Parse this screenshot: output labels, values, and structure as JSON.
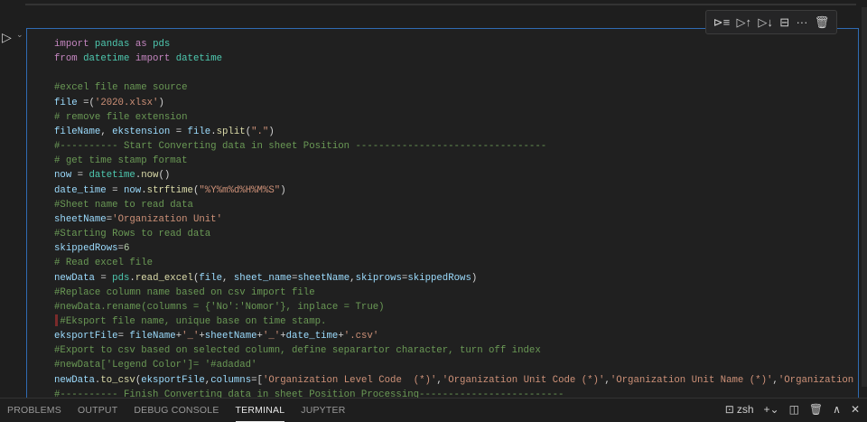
{
  "toolbar": {
    "icons": [
      "run-by-line-icon",
      "execute-above-icon",
      "execute-below-icon",
      "split-cell-icon",
      "more-icon",
      "delete-icon"
    ]
  },
  "code_lines": [
    [
      [
        "k",
        "import"
      ],
      [
        "d",
        " "
      ],
      [
        "m",
        "pandas"
      ],
      [
        "d",
        " "
      ],
      [
        "k",
        "as"
      ],
      [
        "d",
        " "
      ],
      [
        "m",
        "pds"
      ]
    ],
    [
      [
        "k",
        "from"
      ],
      [
        "d",
        " "
      ],
      [
        "m",
        "datetime"
      ],
      [
        "d",
        " "
      ],
      [
        "k",
        "import"
      ],
      [
        "d",
        " "
      ],
      [
        "m",
        "datetime"
      ]
    ],
    [],
    [
      [
        "c",
        "#excel file name source"
      ]
    ],
    [
      [
        "v",
        "file"
      ],
      [
        "d",
        " =("
      ],
      [
        "s",
        "'2020.xlsx'"
      ],
      [
        "d",
        ")"
      ]
    ],
    [
      [
        "c",
        "# remove file extension"
      ]
    ],
    [
      [
        "v",
        "fileName"
      ],
      [
        "d",
        ", "
      ],
      [
        "v",
        "ekstension"
      ],
      [
        "d",
        " = "
      ],
      [
        "v",
        "file"
      ],
      [
        "d",
        "."
      ],
      [
        "f",
        "split"
      ],
      [
        "d",
        "("
      ],
      [
        "s",
        "\".\""
      ],
      [
        "d",
        ")"
      ]
    ],
    [
      [
        "c",
        "#---------- Start Converting data in sheet Position ---------------------------------"
      ]
    ],
    [
      [
        "c",
        "# get time stamp format"
      ]
    ],
    [
      [
        "v",
        "now"
      ],
      [
        "d",
        " = "
      ],
      [
        "m",
        "datetime"
      ],
      [
        "d",
        "."
      ],
      [
        "f",
        "now"
      ],
      [
        "d",
        "()"
      ]
    ],
    [
      [
        "v",
        "date_time"
      ],
      [
        "d",
        " = "
      ],
      [
        "v",
        "now"
      ],
      [
        "d",
        "."
      ],
      [
        "f",
        "strftime"
      ],
      [
        "d",
        "("
      ],
      [
        "s",
        "\"%Y%m%d%H%M%S\""
      ],
      [
        "d",
        ")"
      ]
    ],
    [
      [
        "c",
        "#Sheet name to read data"
      ]
    ],
    [
      [
        "v",
        "sheetName"
      ],
      [
        "d",
        "="
      ],
      [
        "s",
        "'Organization Unit'"
      ]
    ],
    [
      [
        "c",
        "#Starting Rows to read data"
      ]
    ],
    [
      [
        "v",
        "skippedRows"
      ],
      [
        "d",
        "="
      ],
      [
        "n",
        "6"
      ]
    ],
    [
      [
        "c",
        "# Read excel file"
      ]
    ],
    [
      [
        "v",
        "newData"
      ],
      [
        "d",
        " = "
      ],
      [
        "m",
        "pds"
      ],
      [
        "d",
        "."
      ],
      [
        "f",
        "read_excel"
      ],
      [
        "d",
        "("
      ],
      [
        "v",
        "file"
      ],
      [
        "d",
        ", "
      ],
      [
        "v",
        "sheet_name"
      ],
      [
        "d",
        "="
      ],
      [
        "v",
        "sheetName"
      ],
      [
        "d",
        ","
      ],
      [
        "v",
        "skiprows"
      ],
      [
        "d",
        "="
      ],
      [
        "v",
        "skippedRows"
      ],
      [
        "d",
        ")"
      ]
    ],
    [
      [
        "c",
        "#Replace column name based on csv import file"
      ]
    ],
    [
      [
        "c",
        "#newData.rename(columns = {'No':'Nomor'}, inplace = True)"
      ]
    ],
    [
      [
        "c",
        " #Eksport file name, unique base on time stamp."
      ]
    ],
    [
      [
        "v",
        "eksportFile"
      ],
      [
        "d",
        "= "
      ],
      [
        "v",
        "fileName"
      ],
      [
        "d",
        "+"
      ],
      [
        "s",
        "'_'"
      ],
      [
        "d",
        "+"
      ],
      [
        "v",
        "sheetName"
      ],
      [
        "d",
        "+"
      ],
      [
        "s",
        "'_'"
      ],
      [
        "d",
        "+"
      ],
      [
        "v",
        "date_time"
      ],
      [
        "d",
        "+"
      ],
      [
        "s",
        "'.csv'"
      ]
    ],
    [
      [
        "c",
        "#Export to csv based on selected column, define separartor character, turn off index"
      ]
    ],
    [
      [
        "c",
        "#newData['Legend Color']= '#adadad'"
      ]
    ],
    [
      [
        "v",
        "newData"
      ],
      [
        "d",
        "."
      ],
      [
        "f",
        "to_csv"
      ],
      [
        "d",
        "("
      ],
      [
        "v",
        "eksportFile"
      ],
      [
        "d",
        ","
      ],
      [
        "v",
        "columns"
      ],
      [
        "d",
        "=["
      ],
      [
        "s",
        "'Organization Level Code  (*)'"
      ],
      [
        "d",
        ","
      ],
      [
        "s",
        "'Organization Unit Code (*)'"
      ],
      [
        "d",
        ","
      ],
      [
        "s",
        "'Organization Unit Name (*)'"
      ],
      [
        "d",
        ","
      ],
      [
        "s",
        "'Organization"
      ]
    ],
    [
      [
        "c",
        "#---------- Finish Converting data in sheet Position Processing-------------------------"
      ]
    ]
  ],
  "panel": {
    "tabs": [
      "PROBLEMS",
      "OUTPUT",
      "DEBUG CONSOLE",
      "TERMINAL",
      "JUPYTER"
    ],
    "active_tab": "TERMINAL",
    "shell": "zsh"
  }
}
